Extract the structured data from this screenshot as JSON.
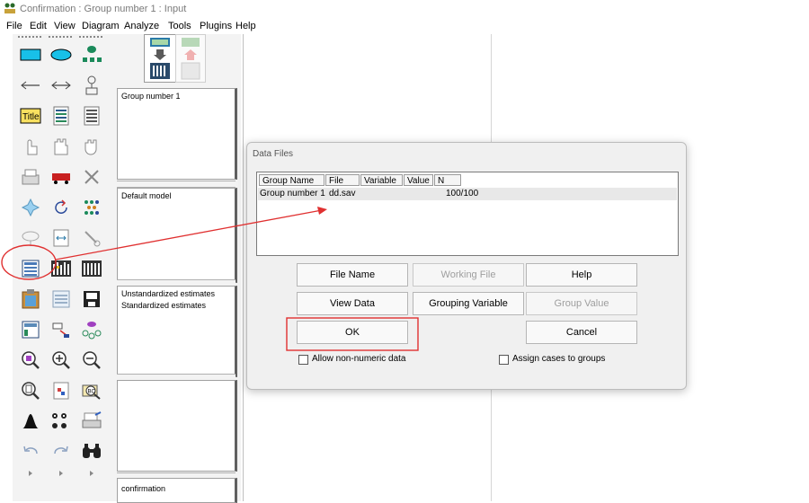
{
  "window": {
    "title": "Confirmation : Group number 1 : Input"
  },
  "menu": [
    "File",
    "Edit",
    "View",
    "Diagram",
    "Analyze",
    "Tools",
    "Plugins",
    "Help"
  ],
  "panels": {
    "group": "Group number 1",
    "model": "Default model",
    "estimates": [
      "Unstandardized estimates",
      "Standardized estimates"
    ],
    "file": "confirmation"
  },
  "dialog": {
    "title": "Data Files",
    "columns": [
      "Group Name",
      "File",
      "Variable",
      "Value",
      "N"
    ],
    "rows": [
      {
        "group": "Group number 1",
        "file": "dd.sav",
        "variable": "",
        "value": "",
        "n": "100/100"
      }
    ],
    "buttons": {
      "file_name": "File Name",
      "working_file": "Working File",
      "help": "Help",
      "view_data": "View Data",
      "grouping_variable": "Grouping Variable",
      "group_value": "Group Value",
      "ok": "OK",
      "cancel": "Cancel"
    },
    "checkboxes": {
      "allow_non_numeric": "Allow non-numeric data",
      "assign_cases": "Assign cases to groups"
    }
  },
  "annotation_color": "#e03030"
}
